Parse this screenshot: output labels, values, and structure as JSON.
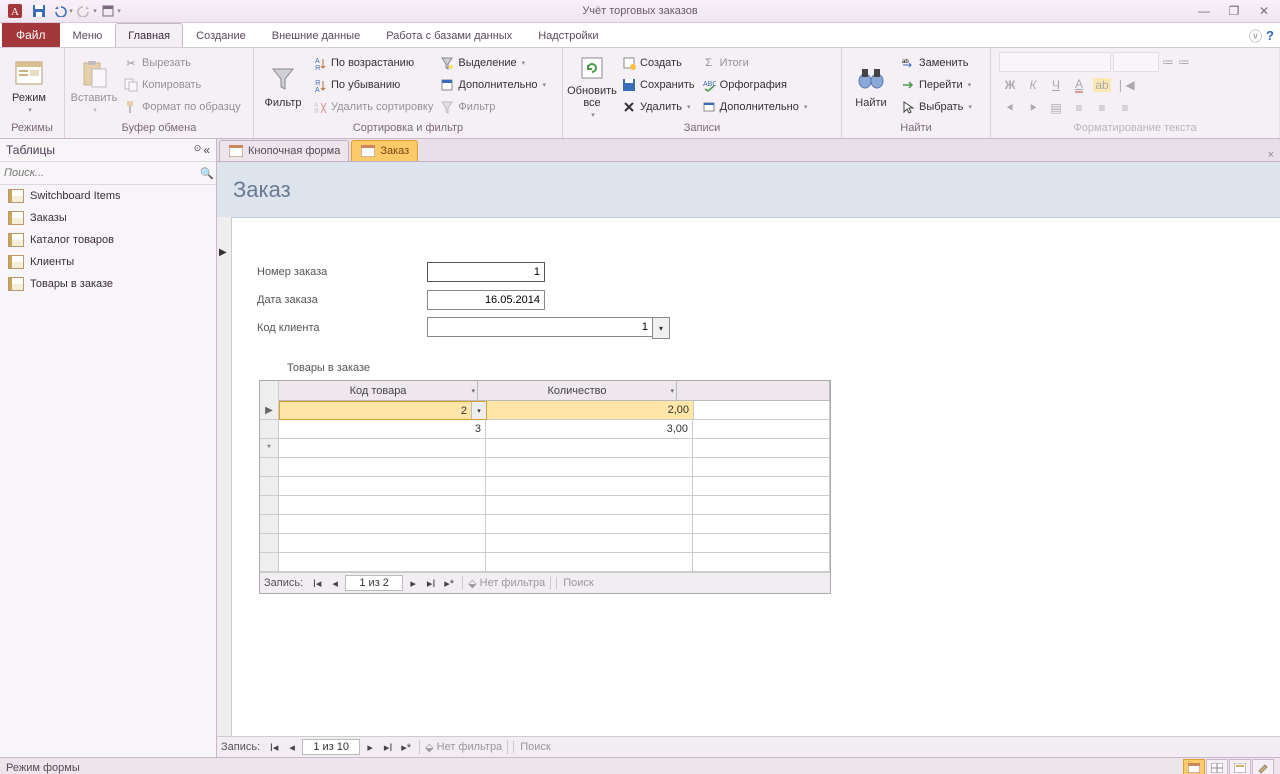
{
  "app_title": "Учёт торговых заказов",
  "menus": {
    "file": "Файл",
    "items": [
      "Меню",
      "Главная",
      "Создание",
      "Внешние данные",
      "Работа с базами данных",
      "Надстройки"
    ],
    "active": 1
  },
  "ribbon": {
    "views": {
      "label": "Режимы",
      "btn": "Режим"
    },
    "clipboard": {
      "label": "Буфер обмена",
      "paste": "Вставить",
      "cut": "Вырезать",
      "copy": "Копировать",
      "fmt": "Формат по образцу"
    },
    "sort": {
      "label": "Сортировка и фильтр",
      "filter": "Фильтр",
      "asc": "По возрастанию",
      "desc": "По убыванию",
      "clear": "Удалить сортировку",
      "sel": "Выделение",
      "adv": "Дополнительно",
      "tog": "Фильтр"
    },
    "records": {
      "label": "Записи",
      "refresh": "Обновить все",
      "new": "Создать",
      "save": "Сохранить",
      "del": "Удалить",
      "totals": "Итоги",
      "spell": "Орфография",
      "more": "Дополнительно"
    },
    "find": {
      "label": "Найти",
      "find": "Найти",
      "replace": "Заменить",
      "goto": "Перейти",
      "select": "Выбрать"
    },
    "textfmt": {
      "label": "Форматирование текста"
    }
  },
  "nav": {
    "header": "Таблицы",
    "search_ph": "Поиск...",
    "items": [
      "Switchboard Items",
      "Заказы",
      "Каталог товаров",
      "Клиенты",
      "Товары в заказе"
    ]
  },
  "tabs": [
    {
      "label": "Кнопочная форма"
    },
    {
      "label": "Заказ"
    }
  ],
  "form": {
    "title": "Заказ",
    "f1": {
      "label": "Номер заказа",
      "value": "1"
    },
    "f2": {
      "label": "Дата заказа",
      "value": "16.05.2014"
    },
    "f3": {
      "label": "Код клиента",
      "value": "1"
    },
    "sub_label": "Товары в заказе",
    "sub_cols": [
      "Код товара",
      "Количество"
    ],
    "sub_rows": [
      {
        "c1": "2",
        "c2": "2,00"
      },
      {
        "c1": "3",
        "c2": "3,00"
      }
    ],
    "sub_nav": {
      "label": "Запись:",
      "pos": "1 из 2",
      "nofilter": "Нет фильтра",
      "search": "Поиск"
    }
  },
  "main_nav": {
    "label": "Запись:",
    "pos": "1 из 10",
    "nofilter": "Нет фильтра",
    "search": "Поиск"
  },
  "status": "Режим формы"
}
